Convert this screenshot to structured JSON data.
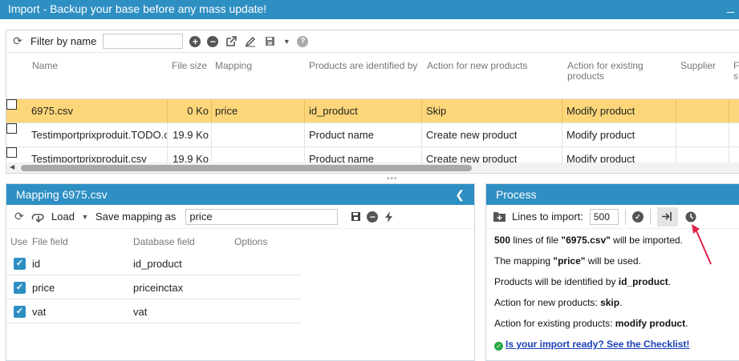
{
  "window": {
    "title": "Import - Backup your base before any mass update!",
    "minimize": "_"
  },
  "top_toolbar": {
    "filter_label": "Filter by name",
    "filter_value": ""
  },
  "files_table": {
    "columns": [
      "Name",
      "File size",
      "Mapping",
      "Products are identified by",
      "Action for new products",
      "Action for existing products",
      "Supplier",
      "F s"
    ],
    "rows": [
      {
        "name": "6975.csv",
        "size": "0 Ko",
        "mapping": "price",
        "identified_by": "id_product",
        "new_action": "Skip",
        "existing_action": "Modify product",
        "supplier": ""
      },
      {
        "name": "Testimportprixproduit.TODO.csv",
        "size": "19.9 Ko",
        "mapping": "",
        "identified_by": "Product name",
        "new_action": "Create new product",
        "existing_action": "Modify product",
        "supplier": ""
      },
      {
        "name": "Testimportprixproduit.csv",
        "size": "19.9 Ko",
        "mapping": "",
        "identified_by": "Product name",
        "new_action": "Create new product",
        "existing_action": "Modify product",
        "supplier": ""
      }
    ]
  },
  "mapping_panel": {
    "title": "Mapping 6975.csv",
    "load_label": "Load",
    "save_label": "Save mapping as",
    "mapping_name": "price",
    "columns": [
      "Use",
      "File field",
      "Database field",
      "Options"
    ],
    "rows": [
      {
        "file_field": "id",
        "db_field": "id_product"
      },
      {
        "file_field": "price",
        "db_field": "priceinctax"
      },
      {
        "file_field": "vat",
        "db_field": "vat"
      }
    ]
  },
  "process_panel": {
    "title": "Process",
    "lines_label": "Lines to import:",
    "lines_value": "500",
    "msg1": {
      "a": "500",
      "b": " lines of file ",
      "c": "\"6975.csv\"",
      "d": " will be imported."
    },
    "msg2": {
      "a": "The mapping ",
      "b": "\"price\"",
      "c": " will be used."
    },
    "msg3": {
      "a": "Products will be identified by ",
      "b": "id_product",
      "c": "."
    },
    "msg4": {
      "a": "Action for new products: ",
      "b": "skip",
      "c": "."
    },
    "msg5": {
      "a": "Action for existing products: ",
      "b": "modify product",
      "c": "."
    },
    "checklist_link": "Is your import ready? See the Checklist!"
  },
  "colors": {
    "header_blue": "#2e8fc3",
    "selected_row": "#fcd679",
    "annotation_arrow": "#e0224a",
    "ok_green": "#2aa844"
  }
}
